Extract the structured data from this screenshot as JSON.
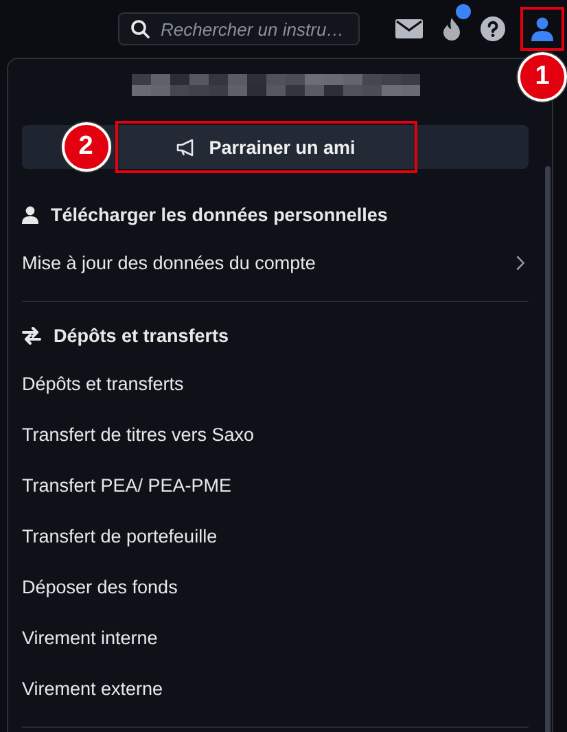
{
  "topbar": {
    "search": {
      "placeholder": "Rechercher un instru…"
    },
    "notifications_unread": true
  },
  "menu": {
    "referral_button": "Parrainer un ami",
    "sections": [
      {
        "heading": "Télécharger les données personnelles",
        "kind": "person",
        "items": [
          {
            "label": "Mise à jour des données du compte",
            "has_submenu": true
          }
        ]
      },
      {
        "heading": "Dépôts et transferts",
        "kind": "transfer",
        "items": [
          {
            "label": "Dépôts et transferts",
            "has_submenu": false
          },
          {
            "label": "Transfert de titres vers Saxo",
            "has_submenu": false
          },
          {
            "label": "Transfert PEA/ PEA-PME",
            "has_submenu": false
          },
          {
            "label": "Transfert de portefeuille",
            "has_submenu": false
          },
          {
            "label": "Déposer des fonds",
            "has_submenu": false
          },
          {
            "label": "Virement interne",
            "has_submenu": false
          },
          {
            "label": "Virement externe",
            "has_submenu": false
          }
        ]
      }
    ]
  },
  "annotations": [
    {
      "number": "1"
    },
    {
      "number": "2"
    }
  ]
}
